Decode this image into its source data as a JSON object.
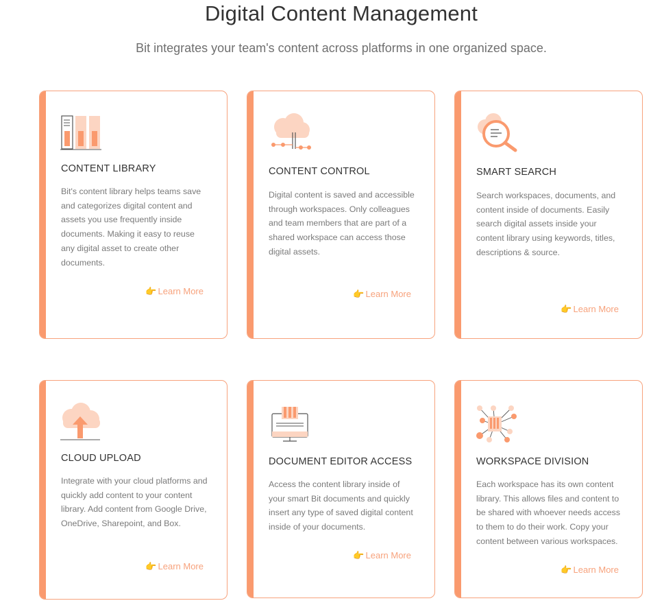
{
  "header": {
    "title": "Digital Content Management",
    "subtitle": "Bit integrates your team's content across platforms in one organized space."
  },
  "colors": {
    "accent": "#fa9a6e",
    "accent_light": "#fcd5c2",
    "link": "#f7a27c",
    "hand": "#f1b53b"
  },
  "cards": [
    {
      "icon": "library-books-icon",
      "title": "CONTENT LIBRARY",
      "body": "Bit's content library helps teams save and categorizes digital content and assets you use frequently inside documents. Making it easy to  reuse any digital asset to create other documents.",
      "link": "Learn More"
    },
    {
      "icon": "cloud-network-icon",
      "title": "CONTENT CONTROL",
      "body": "Digital content is saved and accessible through workspaces. Only colleagues and team members that are part of a shared workspace can access those digital assets.",
      "link": "Learn More"
    },
    {
      "icon": "cloud-search-icon",
      "title": "SMART SEARCH",
      "body": "Search workspaces, documents, and content inside of documents. Easily search digital assets inside your content library using keywords, titles, descriptions & source.",
      "link": "Learn More"
    },
    {
      "icon": "cloud-upload-icon",
      "title": "CLOUD UPLOAD",
      "body": "Integrate with your cloud platforms and quickly add content to your content library. Add content from Google Drive, OneDrive, Sharepoint, and Box.",
      "link": "Learn More"
    },
    {
      "icon": "document-editor-icon",
      "title": "DOCUMENT EDITOR ACCESS",
      "body": "Access the content library inside of your smart Bit documents and quickly insert any type of saved digital content inside of your documents.",
      "link": "Learn More"
    },
    {
      "icon": "workspace-network-icon",
      "title": "WORKSPACE DIVISION",
      "body": "Each workspace has its own content library. This allows files and content to be shared with whoever needs access to them to do their work. Copy your content between various workspaces.",
      "link": "Learn More"
    }
  ]
}
